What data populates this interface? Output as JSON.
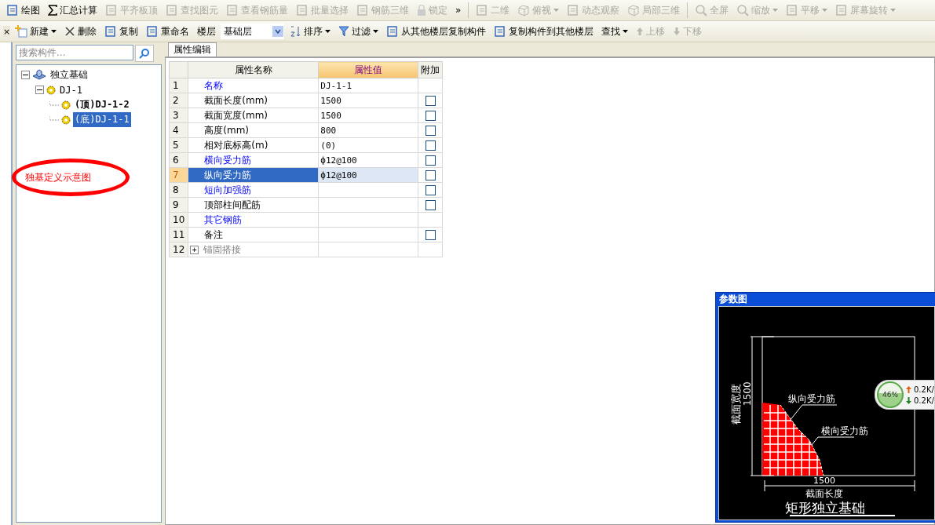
{
  "toolbar_main": [
    {
      "label": "绘图",
      "disabled": false,
      "dropdown": false
    },
    {
      "label": "汇总计算",
      "disabled": false,
      "dropdown": false
    },
    {
      "label": "平齐板顶",
      "disabled": true,
      "dropdown": false
    },
    {
      "label": "查找图元",
      "disabled": true,
      "dropdown": false
    },
    {
      "label": "查看钢筋量",
      "disabled": true,
      "dropdown": false
    },
    {
      "label": "批量选择",
      "disabled": true,
      "dropdown": false
    },
    {
      "label": "钢筋三维",
      "disabled": true,
      "dropdown": false
    },
    {
      "label": "锁定",
      "disabled": true,
      "dropdown": false
    }
  ],
  "overflow": "»",
  "toolbar_view": [
    {
      "label": "二维",
      "disabled": true,
      "dropdown": false
    },
    {
      "label": "俯视",
      "disabled": true,
      "dropdown": true
    },
    {
      "label": "动态观察",
      "disabled": true,
      "dropdown": false
    },
    {
      "label": "局部三维",
      "disabled": true,
      "dropdown": false
    },
    {
      "label": "全屏",
      "disabled": true,
      "dropdown": false
    },
    {
      "label": "缩放",
      "disabled": true,
      "dropdown": true
    },
    {
      "label": "平移",
      "disabled": true,
      "dropdown": true
    },
    {
      "label": "屏幕旋转",
      "disabled": true,
      "dropdown": true
    }
  ],
  "side_close": "×",
  "toolbar_edit": [
    {
      "kind": "button",
      "label": "新建",
      "disabled": false,
      "dropdown": true
    },
    {
      "kind": "button",
      "label": "删除",
      "disabled": false,
      "dropdown": false
    },
    {
      "kind": "button",
      "label": "复制",
      "disabled": false,
      "dropdown": false
    },
    {
      "kind": "button",
      "label": "重命名",
      "disabled": false,
      "dropdown": false
    },
    {
      "kind": "label",
      "label": "楼层"
    },
    {
      "kind": "select",
      "value": "基础层"
    },
    {
      "kind": "button",
      "label": "排序",
      "disabled": false,
      "dropdown": true
    },
    {
      "kind": "button",
      "label": "过滤",
      "disabled": false,
      "dropdown": true
    },
    {
      "kind": "button",
      "label": "从其他楼层复制构件",
      "disabled": false,
      "dropdown": false
    },
    {
      "kind": "button",
      "label": "复制构件到其他楼层",
      "disabled": false,
      "dropdown": false
    },
    {
      "kind": "button",
      "label": "查找",
      "disabled": false,
      "dropdown": true
    },
    {
      "kind": "button",
      "label": "上移",
      "disabled": true,
      "dropdown": false
    },
    {
      "kind": "button",
      "label": "下移",
      "disabled": true,
      "dropdown": false
    }
  ],
  "search": {
    "placeholder": "搜索构件..."
  },
  "tree": [
    {
      "label": "独立基础",
      "bold": false,
      "selected": false,
      "expanded": true,
      "children": [
        {
          "label": "DJ-1",
          "bold": false,
          "selected": false,
          "expanded": true,
          "children": [
            {
              "label": "(顶)DJ-1-2",
              "bold": true,
              "selected": false
            },
            {
              "label": "(底)DJ-1-1",
              "bold": false,
              "selected": true
            }
          ]
        }
      ]
    }
  ],
  "annotation": "独基定义示意图",
  "tab": {
    "label": "属性编辑",
    "selected": true
  },
  "table": {
    "columns": [
      "属性名称",
      "属性值",
      "附加"
    ],
    "rows": [
      {
        "index": "1",
        "name": "名称",
        "kind": "link",
        "value": "DJ-1-1",
        "has_checkbox": false,
        "selected": false
      },
      {
        "index": "2",
        "name": "截面长度(mm)",
        "kind": "plain",
        "value": "1500",
        "has_checkbox": true,
        "checked": false,
        "selected": false
      },
      {
        "index": "3",
        "name": "截面宽度(mm)",
        "kind": "plain",
        "value": "1500",
        "has_checkbox": true,
        "checked": false,
        "selected": false
      },
      {
        "index": "4",
        "name": "高度(mm)",
        "kind": "plain",
        "value": "800",
        "has_checkbox": true,
        "checked": false,
        "selected": false
      },
      {
        "index": "5",
        "name": "相对底标高(m)",
        "kind": "plain",
        "value": "(0)",
        "has_checkbox": true,
        "checked": false,
        "selected": false
      },
      {
        "index": "6",
        "name": "横向受力筋",
        "kind": "link",
        "value": "ф12@100",
        "has_checkbox": true,
        "checked": false,
        "selected": false
      },
      {
        "index": "7",
        "name": "纵向受力筋",
        "kind": "link",
        "value": "ф12@100",
        "has_checkbox": true,
        "checked": false,
        "selected": true
      },
      {
        "index": "8",
        "name": "短向加强筋",
        "kind": "link",
        "value": "",
        "has_checkbox": true,
        "checked": false,
        "selected": false
      },
      {
        "index": "9",
        "name": "顶部柱间配筋",
        "kind": "plain",
        "value": "",
        "has_checkbox": true,
        "checked": false,
        "selected": false
      },
      {
        "index": "10",
        "name": "其它钢筋",
        "kind": "link",
        "value": "",
        "has_checkbox": false,
        "selected": false
      },
      {
        "index": "11",
        "name": "备注",
        "kind": "plain",
        "value": "",
        "has_checkbox": true,
        "checked": false,
        "selected": false
      },
      {
        "index": "12",
        "name": "锚固搭接",
        "kind": "group",
        "expanded": false,
        "expander": "+",
        "value": "",
        "has_checkbox": false,
        "selected": false
      }
    ]
  },
  "diagram_window": {
    "title": "参数图",
    "width_label": "截面宽度",
    "width_value": "1500",
    "length_value": "1500",
    "length_label": "截面长度",
    "rebar_long_label": "纵向受力筋",
    "rebar_trans_label": "横向受力筋",
    "caption": "矩形独立基础"
  },
  "net_widget": {
    "percent": "46%",
    "upload": "0.2K/",
    "download": "0.2K/"
  }
}
